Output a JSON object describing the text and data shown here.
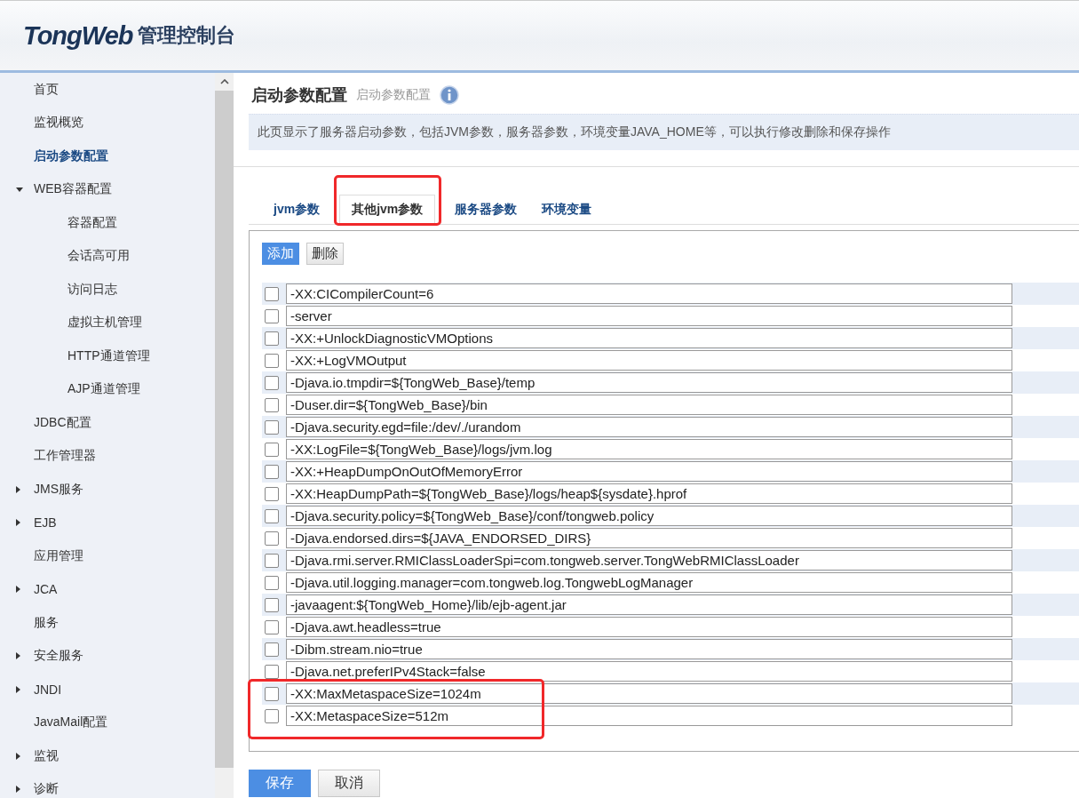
{
  "header": {
    "logo": "TongWeb",
    "title": "管理控制台"
  },
  "sidebar": {
    "items": [
      {
        "label": "首页",
        "selected": false
      },
      {
        "label": "监视概览",
        "selected": false
      },
      {
        "label": "启动参数配置",
        "selected": true
      },
      {
        "label": "WEB容器配置",
        "selected": false,
        "expanded": true,
        "children": [
          {
            "label": "容器配置",
            "selected": false
          },
          {
            "label": "会话高可用",
            "selected": false
          },
          {
            "label": "访问日志",
            "selected": false
          },
          {
            "label": "虚拟主机管理",
            "selected": false
          },
          {
            "label": "HTTP通道管理",
            "selected": false
          },
          {
            "label": "AJP通道管理",
            "selected": false
          }
        ]
      },
      {
        "label": "JDBC配置",
        "selected": false
      },
      {
        "label": "工作管理器",
        "selected": false
      },
      {
        "label": "JMS服务",
        "selected": false,
        "expanded": false
      },
      {
        "label": "EJB",
        "selected": false,
        "expanded": false
      },
      {
        "label": "应用管理",
        "selected": false
      },
      {
        "label": "JCA",
        "selected": false,
        "expanded": false
      },
      {
        "label": "服务",
        "selected": false
      },
      {
        "label": "安全服务",
        "selected": false,
        "expanded": false
      },
      {
        "label": "JNDI",
        "selected": false,
        "expanded": false
      },
      {
        "label": "JavaMail配置",
        "selected": false
      },
      {
        "label": "监视",
        "selected": false,
        "expanded": false
      },
      {
        "label": "诊断",
        "selected": false,
        "expanded": false
      }
    ]
  },
  "page": {
    "title": "启动参数配置",
    "subtitle": "启动参数配置",
    "description": "此页显示了服务器启动参数，包括JVM参数，服务器参数，环境变量JAVA_HOME等，可以执行修改删除和保存操作"
  },
  "tabs": [
    {
      "label": "jvm参数",
      "selected": false,
      "highlighted": false
    },
    {
      "label": "其他jvm参数",
      "selected": true,
      "highlighted": true
    },
    {
      "label": "服务器参数",
      "selected": false,
      "highlighted": false
    },
    {
      "label": "环境变量",
      "selected": false,
      "highlighted": false
    }
  ],
  "toolbar": [
    {
      "label": "添加",
      "kind": "primary"
    },
    {
      "label": "删除",
      "kind": "secondary"
    }
  ],
  "params": [
    {
      "value": "-XX:CICompilerCount=6",
      "checked": false,
      "highlighted": false
    },
    {
      "value": "-server",
      "checked": false,
      "highlighted": false
    },
    {
      "value": "-XX:+UnlockDiagnosticVMOptions",
      "checked": false,
      "highlighted": false
    },
    {
      "value": "-XX:+LogVMOutput",
      "checked": false,
      "highlighted": false
    },
    {
      "value": "-Djava.io.tmpdir=${TongWeb_Base}/temp",
      "checked": false,
      "highlighted": false
    },
    {
      "value": "-Duser.dir=${TongWeb_Base}/bin",
      "checked": false,
      "highlighted": false
    },
    {
      "value": "-Djava.security.egd=file:/dev/./urandom",
      "checked": false,
      "highlighted": false
    },
    {
      "value": "-XX:LogFile=${TongWeb_Base}/logs/jvm.log",
      "checked": false,
      "highlighted": false
    },
    {
      "value": "-XX:+HeapDumpOnOutOfMemoryError",
      "checked": false,
      "highlighted": false
    },
    {
      "value": "-XX:HeapDumpPath=${TongWeb_Base}/logs/heap${sysdate}.hprof",
      "checked": false,
      "highlighted": false
    },
    {
      "value": "-Djava.security.policy=${TongWeb_Base}/conf/tongweb.policy",
      "checked": false,
      "highlighted": false
    },
    {
      "value": "-Djava.endorsed.dirs=${JAVA_ENDORSED_DIRS}",
      "checked": false,
      "highlighted": false
    },
    {
      "value": "-Djava.rmi.server.RMIClassLoaderSpi=com.tongweb.server.TongWebRMIClassLoader",
      "checked": false,
      "highlighted": false
    },
    {
      "value": "-Djava.util.logging.manager=com.tongweb.log.TongwebLogManager",
      "checked": false,
      "highlighted": false
    },
    {
      "value": "-javaagent:${TongWeb_Home}/lib/ejb-agent.jar",
      "checked": false,
      "highlighted": false
    },
    {
      "value": "-Djava.awt.headless=true",
      "checked": false,
      "highlighted": false
    },
    {
      "value": "-Dibm.stream.nio=true",
      "checked": false,
      "highlighted": false
    },
    {
      "value": "-Djava.net.preferIPv4Stack=false",
      "checked": false,
      "highlighted": false
    },
    {
      "value": "-XX:MaxMetaspaceSize=1024m",
      "checked": false,
      "highlighted": true
    },
    {
      "value": "-XX:MetaspaceSize=512m",
      "checked": false,
      "highlighted": true
    }
  ],
  "footer_buttons": [
    {
      "label": "保存",
      "kind": "primary"
    },
    {
      "label": "取消",
      "kind": "secondary"
    }
  ]
}
